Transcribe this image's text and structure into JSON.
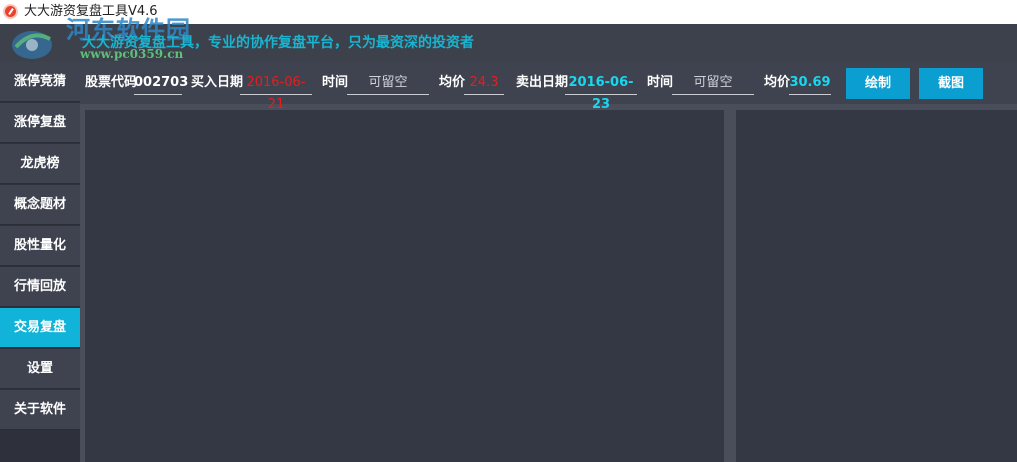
{
  "window": {
    "title": "大大游资复盘工具V4.6"
  },
  "banner": {
    "slogan": "大大游资复盘工具，专业的协作复盘平台，只为最资深的投资者",
    "watermark_title": "河东软件园",
    "watermark_url": "www.pc0359.cn"
  },
  "sidebar": {
    "items": [
      {
        "label": "涨停竞猜"
      },
      {
        "label": "涨停复盘"
      },
      {
        "label": "龙虎榜"
      },
      {
        "label": "概念题材"
      },
      {
        "label": "股性量化"
      },
      {
        "label": "行情回放"
      },
      {
        "label": "交易复盘",
        "active": true
      },
      {
        "label": "设置"
      },
      {
        "label": "关于软件"
      }
    ]
  },
  "toolbar": {
    "stock_code_label": "股票代码",
    "stock_code_value": "002703",
    "buy_date_label": "买入日期",
    "buy_date_value": "2016-06-21",
    "buy_time_label": "时间",
    "buy_time_placeholder": "可留空",
    "buy_price_label": "均价",
    "buy_price_value": "24.3",
    "sell_date_label": "卖出日期",
    "sell_date_value": "2016-06-23",
    "sell_time_label": "时间",
    "sell_time_placeholder": "可留空",
    "sell_price_label": "均价",
    "sell_price_value": "30.69",
    "draw_button": "绘制",
    "screenshot_button": "截图"
  },
  "colors": {
    "accent": "#12b3d8",
    "button": "#0a9ed1",
    "buy_value": "#e21f1f",
    "sell_value": "#19d7ef",
    "panel": "#343844"
  }
}
